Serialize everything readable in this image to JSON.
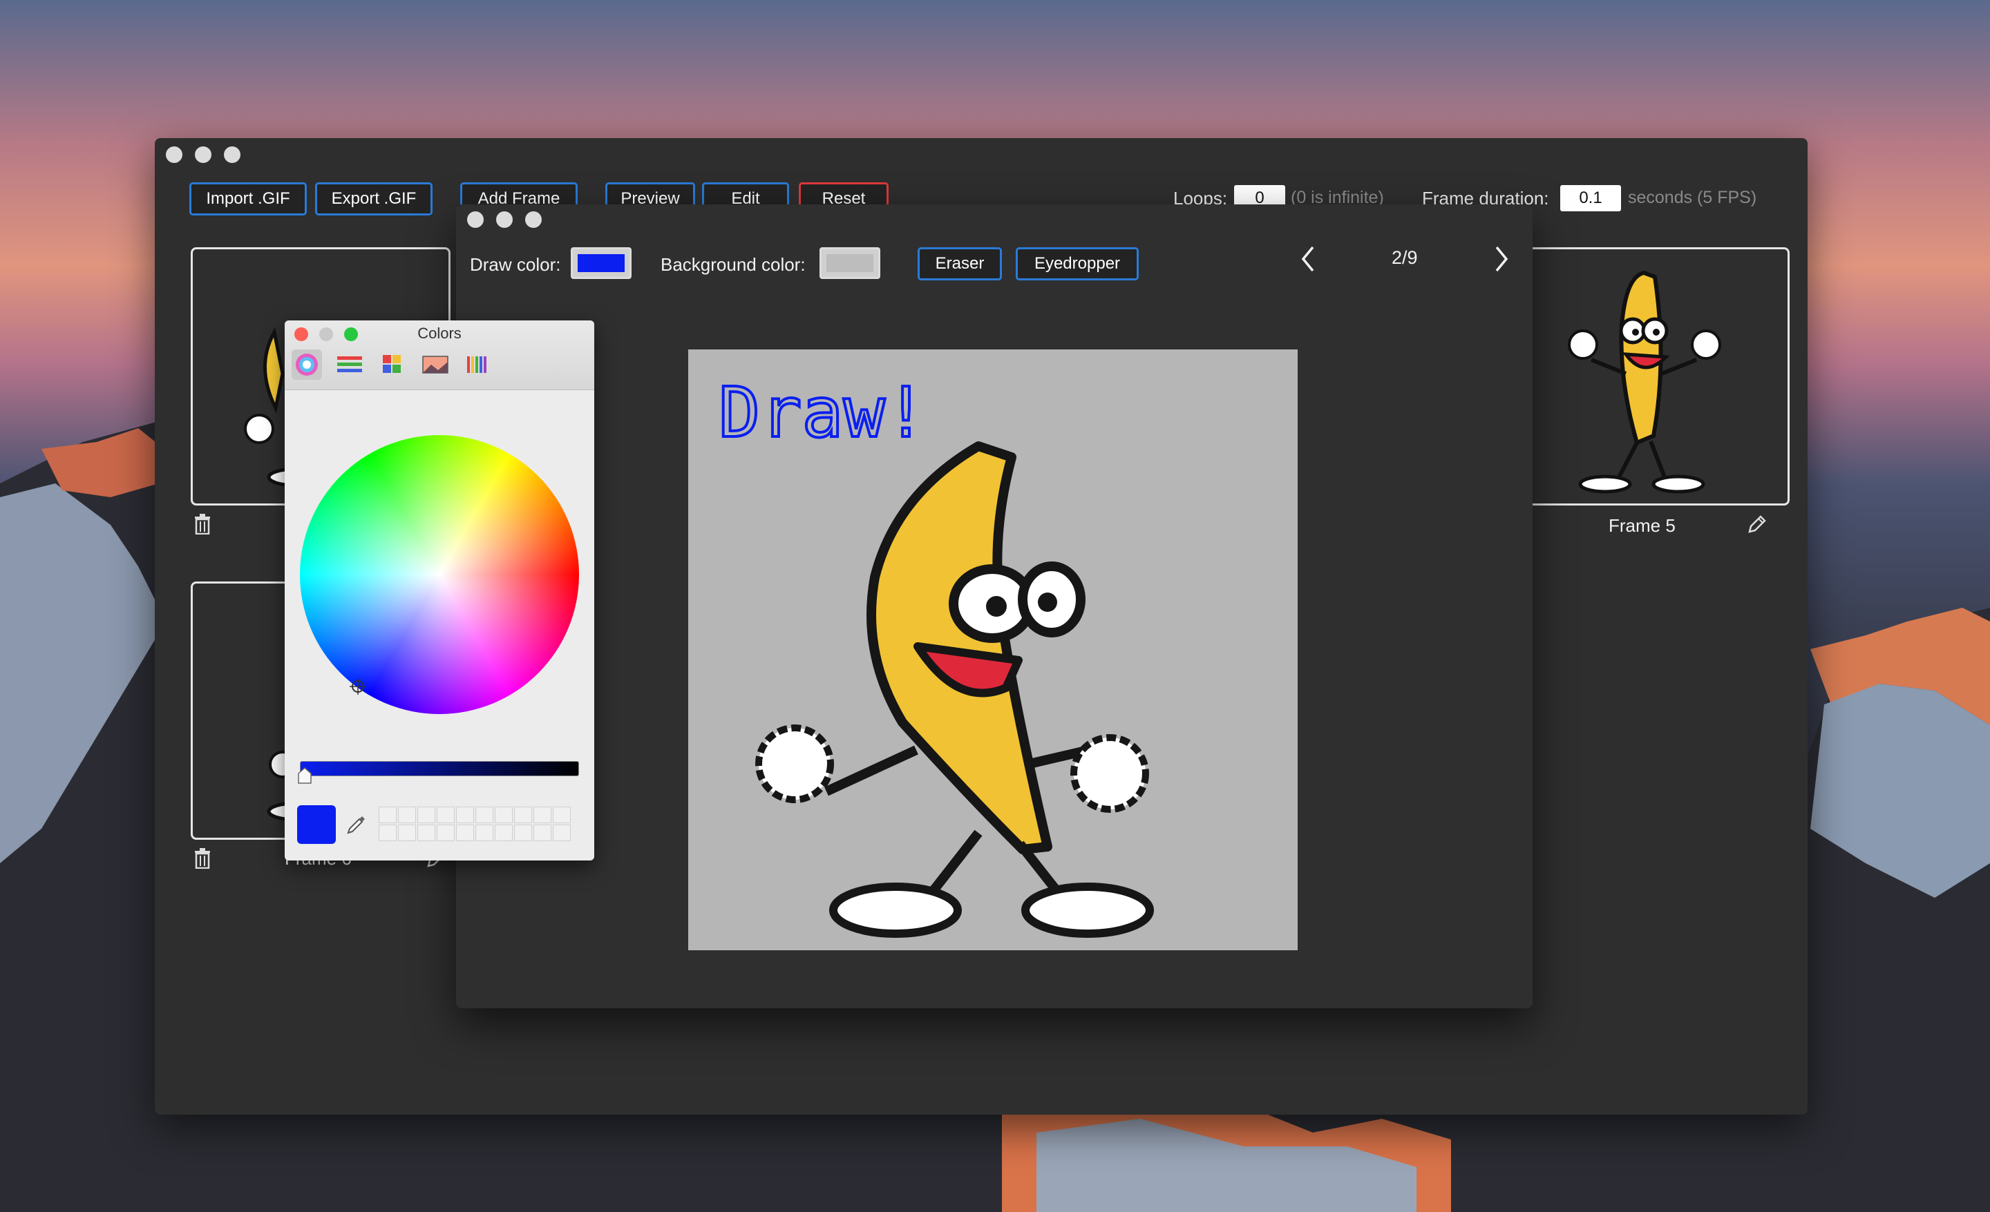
{
  "toolbar": {
    "import_label": "Import .GIF",
    "export_label": "Export .GIF",
    "add_frame_label": "Add Frame",
    "preview_label": "Preview",
    "edit_label": "Edit",
    "reset_label": "Reset",
    "loops_label": "Loops:",
    "loops_value": "0",
    "loops_hint": "(0 is infinite)",
    "frame_duration_label": "Frame duration:",
    "frame_duration_value": "0.1",
    "frame_duration_hint": "seconds (5 FPS)"
  },
  "frames": [
    {
      "label": "Frame 5"
    },
    {
      "label": "Frame 6"
    }
  ],
  "editor": {
    "draw_color_label": "Draw color:",
    "background_color_label": "Background color:",
    "draw_color": "#0a1ff0",
    "background_color": "#b6b6b6",
    "eraser_label": "Eraser",
    "eyedropper_label": "Eyedropper",
    "pager": "2/9",
    "canvas_text": "Draw!"
  },
  "colors_panel": {
    "title": "Colors",
    "current_color": "#0a1ff0"
  },
  "icons": {
    "trash": "trash-icon",
    "pencil": "pencil-icon",
    "prev": "chevron-left-icon",
    "next": "chevron-right-icon",
    "eyedropper": "eyedropper-icon"
  }
}
